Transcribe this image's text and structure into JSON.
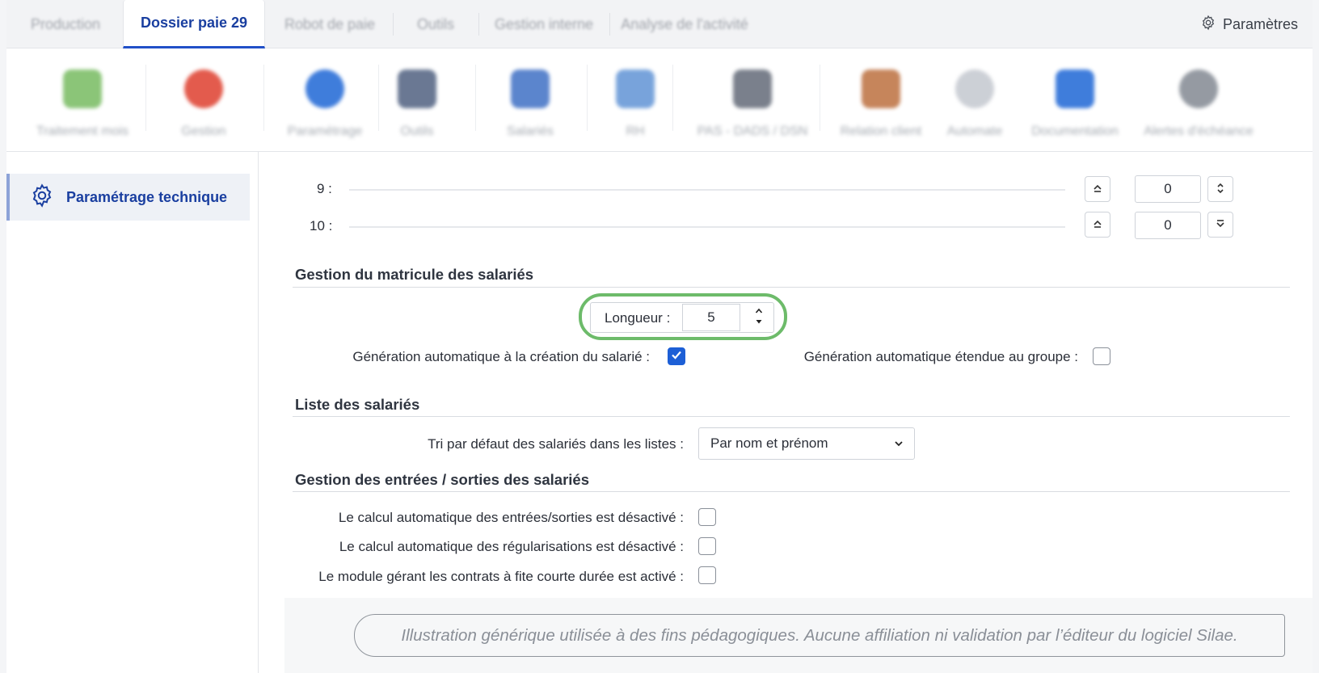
{
  "tabs": [
    {
      "label": "Production",
      "active": false
    },
    {
      "label": "Dossier paie 29",
      "active": true
    },
    {
      "label": "Robot de paie",
      "active": false
    },
    {
      "label": "Outils",
      "active": false
    },
    {
      "label": "Gestion interne",
      "active": false
    },
    {
      "label": "Analyse de l'activité",
      "active": false
    }
  ],
  "header": {
    "settings_label": "Paramètres",
    "settings_icon": "gear-icon"
  },
  "toolbar": [
    {
      "label": "Traitement mois",
      "icon": "calendar-icon",
      "color": "#7fbf6a"
    },
    {
      "label": "Gestion",
      "icon": "g-logo-icon",
      "color": "#e04a3a"
    },
    {
      "label": "Paramétrage",
      "icon": "p-logo-icon",
      "color": "#2b6fd8"
    },
    {
      "label": "Outils",
      "icon": "tools-icon",
      "color": "#5a6a88"
    },
    {
      "label": "Salariés",
      "icon": "people-icon",
      "color": "#4a78c8"
    },
    {
      "label": "RH",
      "icon": "id-card-icon",
      "color": "#6a9ad8"
    },
    {
      "label": "PAS - DADS / DSN",
      "icon": "bank-icon",
      "color": "#6c7380"
    },
    {
      "label": "Relation client",
      "icon": "relation-icon",
      "color": "#c0784a"
    },
    {
      "label": "Automate",
      "icon": "play-icon",
      "color": "#c7cbd2"
    },
    {
      "label": "Documentation",
      "icon": "help-book-icon",
      "color": "#2b6fd8"
    },
    {
      "label": "Alertes d'échéance",
      "icon": "timer-icon",
      "color": "#8a9099"
    }
  ],
  "sidebar": {
    "items": [
      {
        "label": "Paramétrage technique",
        "icon": "gear-icon"
      }
    ]
  },
  "rows": [
    {
      "label": "9 :",
      "value": "0",
      "level": 0
    },
    {
      "label": "10 :",
      "value": "0",
      "level": 0
    }
  ],
  "matricule": {
    "title": "Gestion du matricule des salariés",
    "length_label": "Longueur :",
    "length_value": "5",
    "auto_create_label": "Génération automatique à la création du salarié :",
    "auto_create_checked": true,
    "auto_group_label": "Génération automatique étendue au groupe :",
    "auto_group_checked": false
  },
  "liste": {
    "title": "Liste des salariés",
    "sort_label": "Tri par défaut des salariés dans les listes :",
    "sort_value": "Par nom et prénom"
  },
  "entrees": {
    "title": "Gestion des entrées / sorties des salariés",
    "options": [
      {
        "label": "Le calcul automatique des entrées/sorties est désactivé :",
        "checked": false
      },
      {
        "label": "Le calcul automatique des régularisations est désactivé :",
        "checked": false
      },
      {
        "label": "Le module gérant les contrats à fite courte durée est activé :",
        "checked": false
      }
    ]
  },
  "disclaimer": "Illustration générique utilisée à des fins pédagogiques. Aucune affiliation ni validation par l’éditeur du logiciel Silae.",
  "colors": {
    "accent": "#1a3fa0",
    "checkbox": "#1d5fd6",
    "highlight": "#6dbb6a"
  }
}
